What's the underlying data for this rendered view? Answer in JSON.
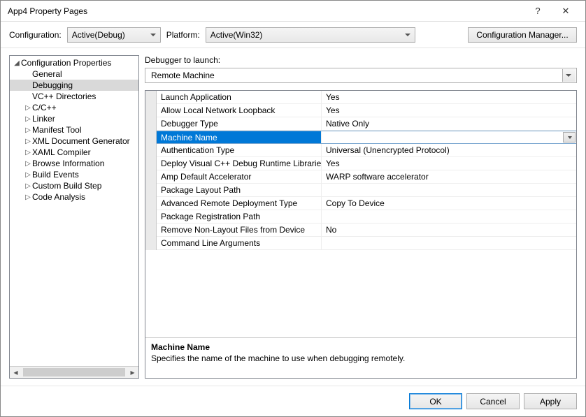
{
  "window": {
    "title": "App4 Property Pages"
  },
  "toolbar": {
    "config_label": "Configuration:",
    "config_value": "Active(Debug)",
    "platform_label": "Platform:",
    "platform_value": "Active(Win32)",
    "config_manager": "Configuration Manager..."
  },
  "tree": {
    "root": "Configuration Properties",
    "items": [
      {
        "label": "General",
        "expander": ""
      },
      {
        "label": "Debugging",
        "expander": "",
        "selected": true
      },
      {
        "label": "VC++ Directories",
        "expander": ""
      },
      {
        "label": "C/C++",
        "expander": "▷"
      },
      {
        "label": "Linker",
        "expander": "▷"
      },
      {
        "label": "Manifest Tool",
        "expander": "▷"
      },
      {
        "label": "XML Document Generator",
        "expander": "▷"
      },
      {
        "label": "XAML Compiler",
        "expander": "▷"
      },
      {
        "label": "Browse Information",
        "expander": "▷"
      },
      {
        "label": "Build Events",
        "expander": "▷"
      },
      {
        "label": "Custom Build Step",
        "expander": "▷"
      },
      {
        "label": "Code Analysis",
        "expander": "▷"
      }
    ]
  },
  "debugger": {
    "label": "Debugger to launch:",
    "value": "Remote Machine"
  },
  "props": [
    {
      "name": "Launch Application",
      "value": "Yes"
    },
    {
      "name": "Allow Local Network Loopback",
      "value": "Yes"
    },
    {
      "name": "Debugger Type",
      "value": "Native Only"
    },
    {
      "name": "Machine Name",
      "value": "",
      "selected": true
    },
    {
      "name": "Authentication Type",
      "value": "Universal (Unencrypted Protocol)"
    },
    {
      "name": "Deploy Visual C++ Debug Runtime Libraries",
      "value": "Yes"
    },
    {
      "name": "Amp Default Accelerator",
      "value": "WARP software accelerator"
    },
    {
      "name": "Package Layout Path",
      "value": ""
    },
    {
      "name": "Advanced Remote Deployment Type",
      "value": "Copy To Device"
    },
    {
      "name": "Package Registration Path",
      "value": ""
    },
    {
      "name": "Remove Non-Layout Files from Device",
      "value": "No"
    },
    {
      "name": "Command Line Arguments",
      "value": ""
    }
  ],
  "description": {
    "title": "Machine Name",
    "text": "Specifies the name of the machine to use when debugging remotely."
  },
  "buttons": {
    "ok": "OK",
    "cancel": "Cancel",
    "apply": "Apply"
  }
}
